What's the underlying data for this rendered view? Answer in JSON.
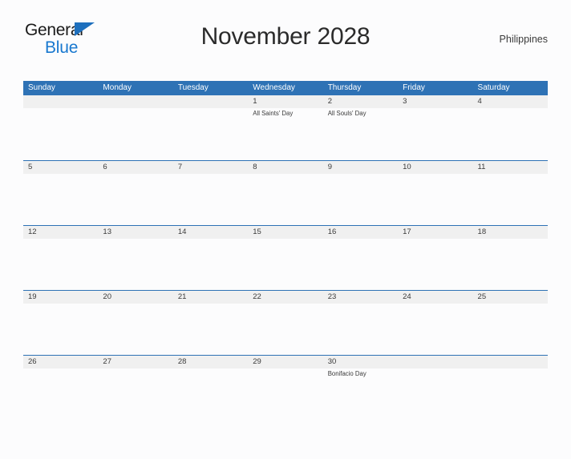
{
  "brand": {
    "name_line1": "General",
    "name_line2": "Blue",
    "flag_icon": "flag-triangle-icon",
    "color_dark": "#1a1a1a",
    "color_blue": "#1878cf"
  },
  "header": {
    "title": "November 2028",
    "locale": "Philippines"
  },
  "theme": {
    "header_blue": "#2e72b5",
    "band_gray": "#f0f0f0",
    "page_background": "#fcfcfd",
    "text": "#3a3a3a"
  },
  "calendar": {
    "month": "November",
    "year": "2028",
    "weekdays": [
      "Sunday",
      "Monday",
      "Tuesday",
      "Wednesday",
      "Thursday",
      "Friday",
      "Saturday"
    ],
    "weeks": [
      [
        {
          "date": "",
          "events": []
        },
        {
          "date": "",
          "events": []
        },
        {
          "date": "",
          "events": []
        },
        {
          "date": "1",
          "events": [
            "All Saints' Day"
          ]
        },
        {
          "date": "2",
          "events": [
            "All Souls' Day"
          ]
        },
        {
          "date": "3",
          "events": []
        },
        {
          "date": "4",
          "events": []
        }
      ],
      [
        {
          "date": "5",
          "events": []
        },
        {
          "date": "6",
          "events": []
        },
        {
          "date": "7",
          "events": []
        },
        {
          "date": "8",
          "events": []
        },
        {
          "date": "9",
          "events": []
        },
        {
          "date": "10",
          "events": []
        },
        {
          "date": "11",
          "events": []
        }
      ],
      [
        {
          "date": "12",
          "events": []
        },
        {
          "date": "13",
          "events": []
        },
        {
          "date": "14",
          "events": []
        },
        {
          "date": "15",
          "events": []
        },
        {
          "date": "16",
          "events": []
        },
        {
          "date": "17",
          "events": []
        },
        {
          "date": "18",
          "events": []
        }
      ],
      [
        {
          "date": "19",
          "events": []
        },
        {
          "date": "20",
          "events": []
        },
        {
          "date": "21",
          "events": []
        },
        {
          "date": "22",
          "events": []
        },
        {
          "date": "23",
          "events": []
        },
        {
          "date": "24",
          "events": []
        },
        {
          "date": "25",
          "events": []
        }
      ],
      [
        {
          "date": "26",
          "events": []
        },
        {
          "date": "27",
          "events": []
        },
        {
          "date": "28",
          "events": []
        },
        {
          "date": "29",
          "events": []
        },
        {
          "date": "30",
          "events": [
            "Bonifacio Day"
          ]
        },
        {
          "date": "",
          "events": []
        },
        {
          "date": "",
          "events": []
        }
      ]
    ]
  }
}
